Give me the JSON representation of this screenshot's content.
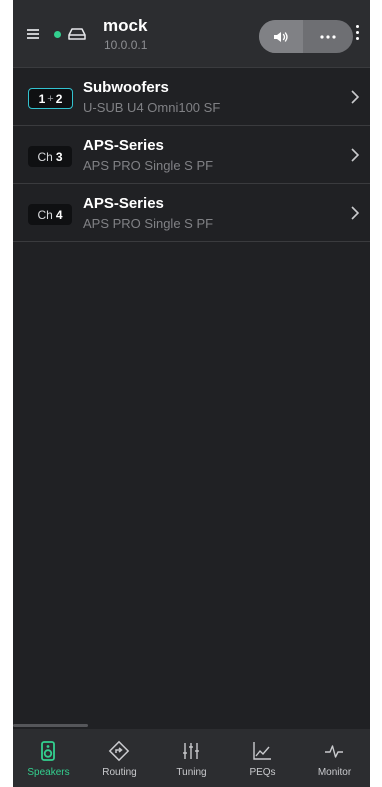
{
  "header": {
    "device_name": "mock",
    "device_ip": "10.0.0.1",
    "status_color": "#33d08f",
    "icons": [
      "menu-icon",
      "status-dot",
      "device-icon",
      "volume-icon",
      "more-horizontal-icon",
      "more-vertical-icon"
    ]
  },
  "speakers": [
    {
      "badge_pre": "",
      "badge_a": "1",
      "badge_sep": "+",
      "badge_b": "2",
      "title": "Subwoofers",
      "model": "U-SUB U4 Omni100 SF"
    },
    {
      "badge_pre": "Ch",
      "badge_a": "3",
      "title": "APS-Series",
      "model": "APS PRO Single S PF"
    },
    {
      "badge_pre": "Ch",
      "badge_a": "4",
      "title": "APS-Series",
      "model": "APS PRO Single S PF"
    }
  ],
  "nav": {
    "active": "Speakers",
    "accent_color": "#33d08f",
    "items": [
      {
        "label": "Speakers",
        "icon": "speaker-icon"
      },
      {
        "label": "Routing",
        "icon": "routing-icon"
      },
      {
        "label": "Tuning",
        "icon": "sliders-icon"
      },
      {
        "label": "PEQs",
        "icon": "chart-line-icon"
      },
      {
        "label": "Monitor",
        "icon": "pulse-icon"
      }
    ]
  }
}
